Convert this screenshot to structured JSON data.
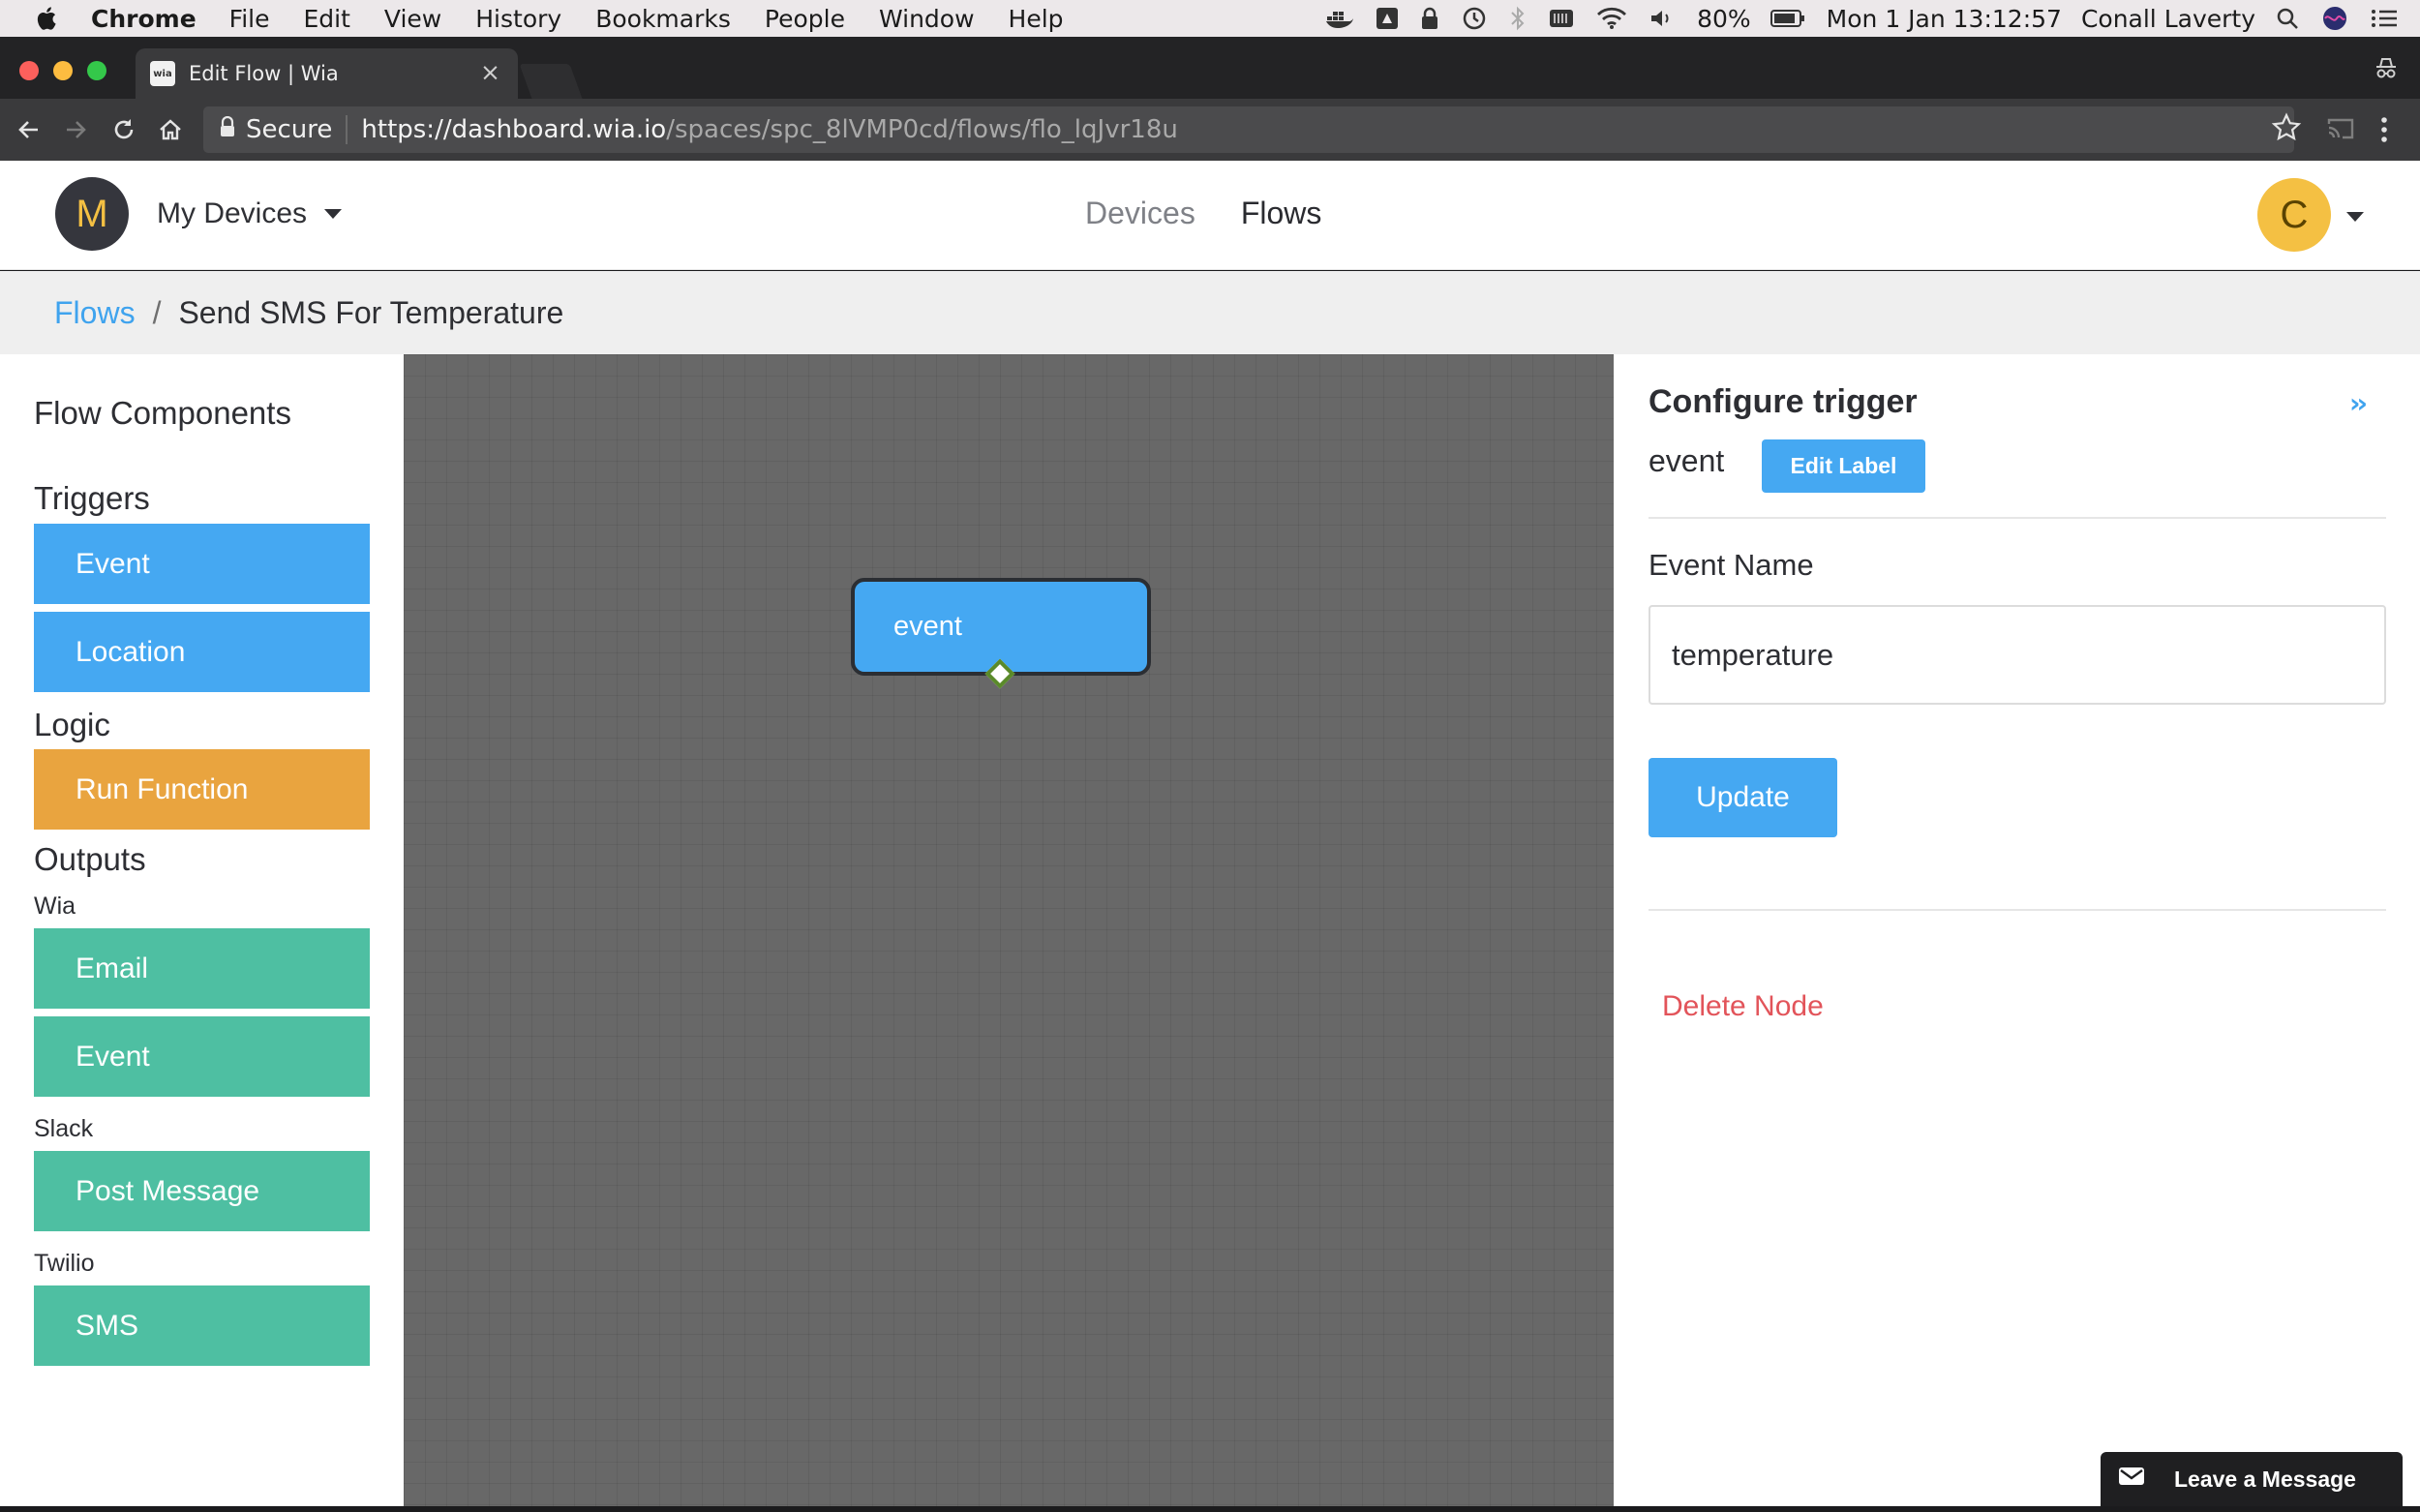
{
  "menubar": {
    "app_name": "Chrome",
    "items": [
      "File",
      "Edit",
      "View",
      "History",
      "Bookmarks",
      "People",
      "Window",
      "Help"
    ],
    "battery": "80%",
    "datetime": "Mon 1 Jan  13:12:57",
    "user": "Conall Laverty"
  },
  "browser": {
    "tab_title": "Edit Flow | Wia",
    "favicon_text": "wia",
    "secure_label": "Secure",
    "url_host": "https://dashboard.wia.io",
    "url_path": "/spaces/spc_8lVMP0cd/flows/flo_lqJvr18u"
  },
  "header": {
    "space_initial": "M",
    "space_name": "My Devices",
    "nav": {
      "devices": "Devices",
      "flows": "Flows"
    },
    "user_initial": "C"
  },
  "breadcrumb": {
    "parent": "Flows",
    "separator": "/",
    "current": "Send SMS For Temperature"
  },
  "sidebar": {
    "title": "Flow Components",
    "triggers_title": "Triggers",
    "triggers": [
      "Event",
      "Location"
    ],
    "logic_title": "Logic",
    "logic": [
      "Run Function"
    ],
    "outputs_title": "Outputs",
    "wia_title": "Wia",
    "wia": [
      "Email",
      "Event"
    ],
    "slack_title": "Slack",
    "slack": [
      "Post Message"
    ],
    "twilio_title": "Twilio",
    "twilio": [
      "SMS"
    ]
  },
  "canvas": {
    "node_label": "event"
  },
  "panel": {
    "title": "Configure trigger",
    "collapse": "››",
    "node_label": "event",
    "edit_label_button": "Edit Label",
    "field_label": "Event Name",
    "event_name_value": "temperature",
    "update_button": "Update",
    "delete_node": "Delete Node"
  },
  "chat_widget": {
    "label": "Leave a Message"
  },
  "colors": {
    "trigger": "#45a8f2",
    "logic": "#e9a43f",
    "output": "#4ebfa2",
    "danger": "#e2545a",
    "link": "#3fa3ee"
  }
}
